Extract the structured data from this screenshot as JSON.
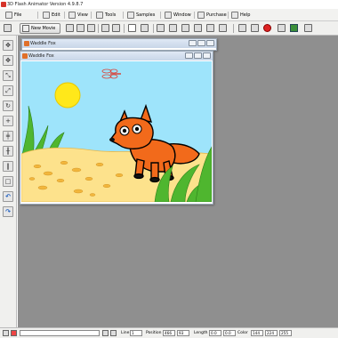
{
  "app": {
    "title": "3D Flash Animator Version 4.9.8.7"
  },
  "menu": [
    {
      "label": "File",
      "icon": "file-icon"
    },
    {
      "label": "Edit",
      "icon": "edit-icon"
    },
    {
      "label": "View",
      "icon": "view-icon"
    },
    {
      "label": "Tools",
      "icon": "tools-icon"
    },
    {
      "label": "Samples",
      "icon": "samples-icon"
    },
    {
      "label": "Window",
      "icon": "window-icon"
    },
    {
      "label": "Purchase",
      "icon": "purchase-icon"
    },
    {
      "label": "Help",
      "icon": "help-icon"
    }
  ],
  "toolbar": {
    "new_movie_label": "New Movie"
  },
  "windows": {
    "back_title": "Waddle Fox",
    "front_title": "Waddle Fox"
  },
  "status": {
    "line_label": "Line",
    "line_value": "1",
    "position_label": "Position",
    "pos_x": "466",
    "pos_y": "93",
    "length_label": "Length",
    "len_x": "0.0",
    "len_y": "0.0",
    "color_label": "Color",
    "color_r": "144",
    "color_g": "224",
    "color_b": "255"
  },
  "colors": {
    "sky": "#9ee4fb",
    "sand": "#fde28c",
    "fox": "#f26a1b",
    "sun": "#ffe81a",
    "grass": "#4fb62f"
  }
}
